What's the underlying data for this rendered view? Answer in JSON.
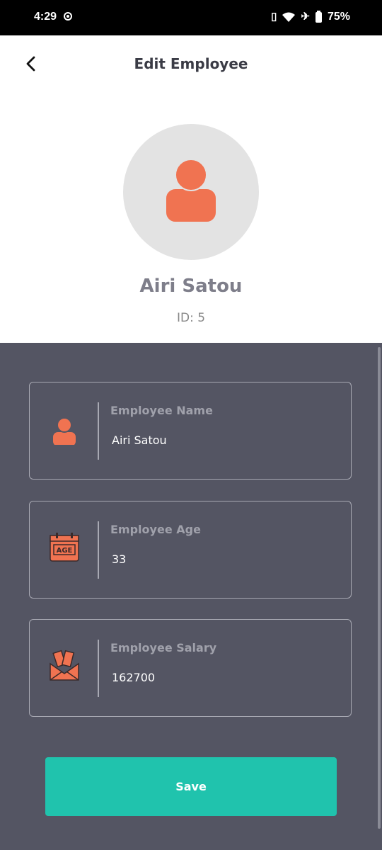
{
  "status_bar": {
    "time": "4:29",
    "battery": "75%",
    "icons": [
      "record-icon",
      "vibrate-icon",
      "wifi-icon",
      "airplane-icon",
      "battery-icon"
    ]
  },
  "header": {
    "title": "Edit Employee",
    "back_icon": "chevron-left-icon"
  },
  "profile": {
    "name": "Airi Satou",
    "id_text": "ID: 5",
    "avatar_icon": "person-icon"
  },
  "form": {
    "fields": [
      {
        "label": "Employee Name",
        "value": "Airi Satou",
        "icon": "person-icon"
      },
      {
        "label": "Employee Age",
        "value": "33",
        "icon": "age-calendar-icon",
        "icon_text": "AGE"
      },
      {
        "label": "Employee Salary",
        "value": "162700",
        "icon": "money-envelope-icon"
      }
    ],
    "save_label": "Save"
  },
  "colors": {
    "accent": "#20c3ad",
    "icon_orange": "#f07351",
    "form_bg": "#545563",
    "header_bg": "#ffffff"
  }
}
